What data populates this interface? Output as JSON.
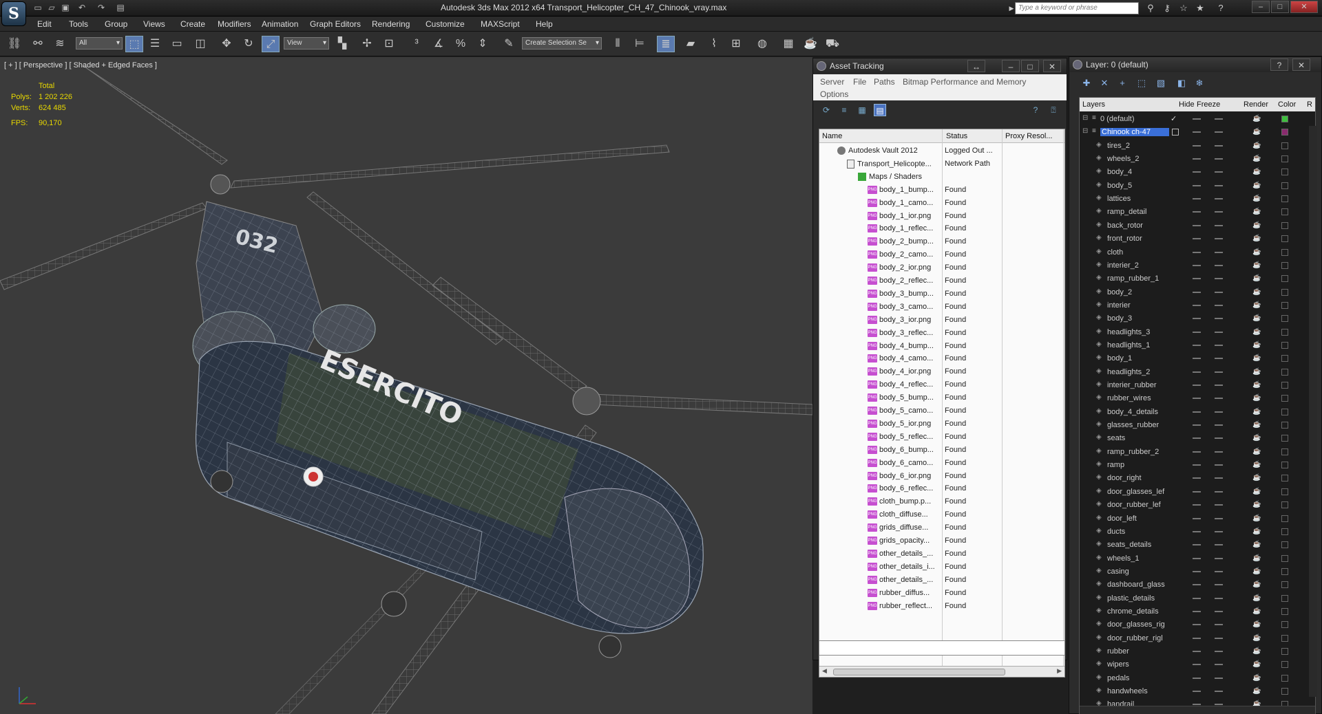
{
  "app": {
    "title": "Autodesk 3ds Max  2012 x64      Transport_Helicopter_CH_47_Chinook_vray.max",
    "search_placeholder": "Type a keyword or phrase"
  },
  "menubar": [
    "Edit",
    "Tools",
    "Group",
    "Views",
    "Create",
    "Modifiers",
    "Animation",
    "Graph Editors",
    "Rendering",
    "Customize",
    "MAXScript",
    "Help"
  ],
  "toolbar": {
    "selection_filter": "All",
    "reference_coord": "View",
    "named_selection": "Create Selection Se"
  },
  "viewport": {
    "label": "[ + ] [ Perspective ] [ Shaded + Edged Faces ]",
    "stats": {
      "header": "Total",
      "polys_label": "Polys:",
      "polys": "1 202 226",
      "verts_label": "Verts:",
      "verts": "624 485",
      "fps_label": "FPS:",
      "fps": "90,170"
    },
    "model_text": "ESERCITO",
    "tail_number": "032"
  },
  "asset_tracking": {
    "title": "Asset Tracking",
    "menu": [
      "Server",
      "File",
      "Paths",
      "Bitmap Performance and Memory",
      "Options"
    ],
    "columns": [
      "Name",
      "Status",
      "Proxy Resol..."
    ],
    "rows": [
      {
        "name": "Autodesk Vault 2012",
        "status": "Logged Out ...",
        "kind": "vault",
        "indent": 1
      },
      {
        "name": "Transport_Helicopte...",
        "status": "Network Path",
        "kind": "file",
        "indent": 2
      },
      {
        "name": "Maps / Shaders",
        "status": "",
        "kind": "maps",
        "indent": 3
      },
      {
        "name": "body_1_bump...",
        "status": "Found",
        "kind": "png",
        "indent": 4
      },
      {
        "name": "body_1_camo...",
        "status": "Found",
        "kind": "png",
        "indent": 4
      },
      {
        "name": "body_1_ior.png",
        "status": "Found",
        "kind": "png",
        "indent": 4
      },
      {
        "name": "body_1_reflec...",
        "status": "Found",
        "kind": "png",
        "indent": 4
      },
      {
        "name": "body_2_bump...",
        "status": "Found",
        "kind": "png",
        "indent": 4
      },
      {
        "name": "body_2_camo...",
        "status": "Found",
        "kind": "png",
        "indent": 4
      },
      {
        "name": "body_2_ior.png",
        "status": "Found",
        "kind": "png",
        "indent": 4
      },
      {
        "name": "body_2_reflec...",
        "status": "Found",
        "kind": "png",
        "indent": 4
      },
      {
        "name": "body_3_bump...",
        "status": "Found",
        "kind": "png",
        "indent": 4
      },
      {
        "name": "body_3_camo...",
        "status": "Found",
        "kind": "png",
        "indent": 4
      },
      {
        "name": "body_3_ior.png",
        "status": "Found",
        "kind": "png",
        "indent": 4
      },
      {
        "name": "body_3_reflec...",
        "status": "Found",
        "kind": "png",
        "indent": 4
      },
      {
        "name": "body_4_bump...",
        "status": "Found",
        "kind": "png",
        "indent": 4
      },
      {
        "name": "body_4_camo...",
        "status": "Found",
        "kind": "png",
        "indent": 4
      },
      {
        "name": "body_4_ior.png",
        "status": "Found",
        "kind": "png",
        "indent": 4
      },
      {
        "name": "body_4_reflec...",
        "status": "Found",
        "kind": "png",
        "indent": 4
      },
      {
        "name": "body_5_bump...",
        "status": "Found",
        "kind": "png",
        "indent": 4
      },
      {
        "name": "body_5_camo...",
        "status": "Found",
        "kind": "png",
        "indent": 4
      },
      {
        "name": "body_5_ior.png",
        "status": "Found",
        "kind": "png",
        "indent": 4
      },
      {
        "name": "body_5_reflec...",
        "status": "Found",
        "kind": "png",
        "indent": 4
      },
      {
        "name": "body_6_bump...",
        "status": "Found",
        "kind": "png",
        "indent": 4
      },
      {
        "name": "body_6_camo...",
        "status": "Found",
        "kind": "png",
        "indent": 4
      },
      {
        "name": "body_6_ior.png",
        "status": "Found",
        "kind": "png",
        "indent": 4
      },
      {
        "name": "body_6_reflec...",
        "status": "Found",
        "kind": "png",
        "indent": 4
      },
      {
        "name": "cloth_bump.p...",
        "status": "Found",
        "kind": "png",
        "indent": 4
      },
      {
        "name": "cloth_diffuse...",
        "status": "Found",
        "kind": "png",
        "indent": 4
      },
      {
        "name": "grids_diffuse...",
        "status": "Found",
        "kind": "png",
        "indent": 4
      },
      {
        "name": "grids_opacity...",
        "status": "Found",
        "kind": "png",
        "indent": 4
      },
      {
        "name": "other_details_...",
        "status": "Found",
        "kind": "png",
        "indent": 4
      },
      {
        "name": "other_details_i...",
        "status": "Found",
        "kind": "png",
        "indent": 4
      },
      {
        "name": "other_details_...",
        "status": "Found",
        "kind": "png",
        "indent": 4
      },
      {
        "name": "rubber_diffus...",
        "status": "Found",
        "kind": "png",
        "indent": 4
      },
      {
        "name": "rubber_reflect...",
        "status": "Found",
        "kind": "png",
        "indent": 4
      }
    ]
  },
  "layers": {
    "title": "Layer: 0 (default)",
    "columns": [
      "Layers",
      "Hide",
      "Freeze",
      "Render",
      "Color",
      "R"
    ],
    "rows": [
      {
        "name": "0 (default)",
        "level": 0,
        "swatch": "#3fbf3f"
      },
      {
        "name": "Chinook ch-47",
        "level": 0,
        "selected": true,
        "swatch": "#8a2b6e"
      },
      {
        "name": "tires_2",
        "level": 1
      },
      {
        "name": "wheels_2",
        "level": 1
      },
      {
        "name": "body_4",
        "level": 1
      },
      {
        "name": "body_5",
        "level": 1
      },
      {
        "name": "lattices",
        "level": 1
      },
      {
        "name": "ramp_detail",
        "level": 1
      },
      {
        "name": "back_rotor",
        "level": 1
      },
      {
        "name": "front_rotor",
        "level": 1
      },
      {
        "name": "cloth",
        "level": 1
      },
      {
        "name": "interier_2",
        "level": 1
      },
      {
        "name": "ramp_rubber_1",
        "level": 1
      },
      {
        "name": "body_2",
        "level": 1
      },
      {
        "name": "interier",
        "level": 1
      },
      {
        "name": "body_3",
        "level": 1
      },
      {
        "name": "headlights_3",
        "level": 1
      },
      {
        "name": "headlights_1",
        "level": 1
      },
      {
        "name": "body_1",
        "level": 1
      },
      {
        "name": "headlights_2",
        "level": 1
      },
      {
        "name": "interier_rubber",
        "level": 1
      },
      {
        "name": "rubber_wires",
        "level": 1
      },
      {
        "name": "body_4_details",
        "level": 1
      },
      {
        "name": "glasses_rubber",
        "level": 1
      },
      {
        "name": "seats",
        "level": 1
      },
      {
        "name": "ramp_rubber_2",
        "level": 1
      },
      {
        "name": "ramp",
        "level": 1
      },
      {
        "name": "door_right",
        "level": 1
      },
      {
        "name": "door_glasses_lef",
        "level": 1
      },
      {
        "name": "door_rubber_lef",
        "level": 1
      },
      {
        "name": "door_left",
        "level": 1
      },
      {
        "name": "ducts",
        "level": 1
      },
      {
        "name": "seats_details",
        "level": 1
      },
      {
        "name": "wheels_1",
        "level": 1
      },
      {
        "name": "casing",
        "level": 1
      },
      {
        "name": "dashboard_glass",
        "level": 1
      },
      {
        "name": "plastic_details",
        "level": 1
      },
      {
        "name": "chrome_details",
        "level": 1
      },
      {
        "name": "door_glasses_rig",
        "level": 1
      },
      {
        "name": "door_rubber_rigl",
        "level": 1
      },
      {
        "name": "rubber",
        "level": 1
      },
      {
        "name": "wipers",
        "level": 1
      },
      {
        "name": "pedals",
        "level": 1
      },
      {
        "name": "handwheels",
        "level": 1
      },
      {
        "name": "handrail",
        "level": 1
      }
    ]
  }
}
